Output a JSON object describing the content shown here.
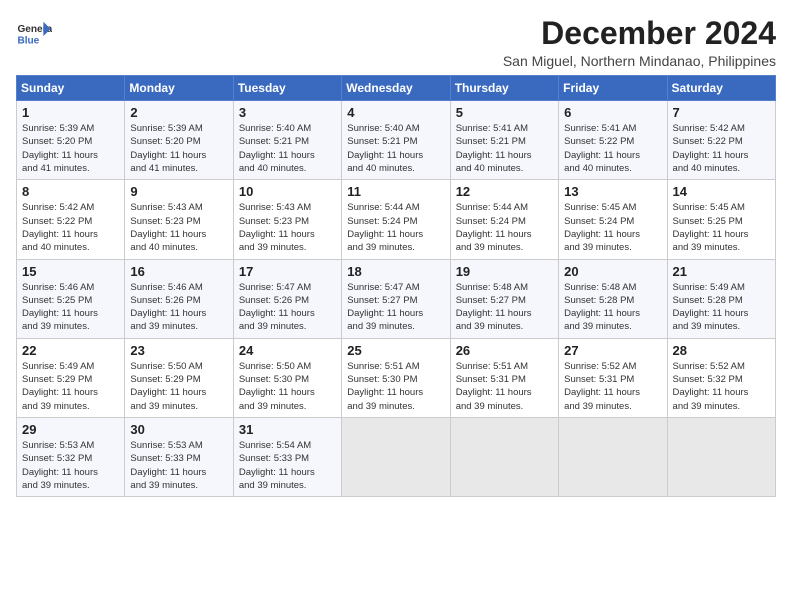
{
  "header": {
    "logo_line1": "General",
    "logo_line2": "Blue",
    "month": "December 2024",
    "location": "San Miguel, Northern Mindanao, Philippines"
  },
  "weekdays": [
    "Sunday",
    "Monday",
    "Tuesday",
    "Wednesday",
    "Thursday",
    "Friday",
    "Saturday"
  ],
  "weeks": [
    [
      {
        "day": 1,
        "sunrise": "5:39 AM",
        "sunset": "5:20 PM",
        "daylight": "11 hours and 41 minutes"
      },
      {
        "day": 2,
        "sunrise": "5:39 AM",
        "sunset": "5:20 PM",
        "daylight": "11 hours and 41 minutes"
      },
      {
        "day": 3,
        "sunrise": "5:40 AM",
        "sunset": "5:21 PM",
        "daylight": "11 hours and 40 minutes"
      },
      {
        "day": 4,
        "sunrise": "5:40 AM",
        "sunset": "5:21 PM",
        "daylight": "11 hours and 40 minutes"
      },
      {
        "day": 5,
        "sunrise": "5:41 AM",
        "sunset": "5:21 PM",
        "daylight": "11 hours and 40 minutes"
      },
      {
        "day": 6,
        "sunrise": "5:41 AM",
        "sunset": "5:22 PM",
        "daylight": "11 hours and 40 minutes"
      },
      {
        "day": 7,
        "sunrise": "5:42 AM",
        "sunset": "5:22 PM",
        "daylight": "11 hours and 40 minutes"
      }
    ],
    [
      {
        "day": 8,
        "sunrise": "5:42 AM",
        "sunset": "5:22 PM",
        "daylight": "11 hours and 40 minutes"
      },
      {
        "day": 9,
        "sunrise": "5:43 AM",
        "sunset": "5:23 PM",
        "daylight": "11 hours and 40 minutes"
      },
      {
        "day": 10,
        "sunrise": "5:43 AM",
        "sunset": "5:23 PM",
        "daylight": "11 hours and 39 minutes"
      },
      {
        "day": 11,
        "sunrise": "5:44 AM",
        "sunset": "5:24 PM",
        "daylight": "11 hours and 39 minutes"
      },
      {
        "day": 12,
        "sunrise": "5:44 AM",
        "sunset": "5:24 PM",
        "daylight": "11 hours and 39 minutes"
      },
      {
        "day": 13,
        "sunrise": "5:45 AM",
        "sunset": "5:24 PM",
        "daylight": "11 hours and 39 minutes"
      },
      {
        "day": 14,
        "sunrise": "5:45 AM",
        "sunset": "5:25 PM",
        "daylight": "11 hours and 39 minutes"
      }
    ],
    [
      {
        "day": 15,
        "sunrise": "5:46 AM",
        "sunset": "5:25 PM",
        "daylight": "11 hours and 39 minutes"
      },
      {
        "day": 16,
        "sunrise": "5:46 AM",
        "sunset": "5:26 PM",
        "daylight": "11 hours and 39 minutes"
      },
      {
        "day": 17,
        "sunrise": "5:47 AM",
        "sunset": "5:26 PM",
        "daylight": "11 hours and 39 minutes"
      },
      {
        "day": 18,
        "sunrise": "5:47 AM",
        "sunset": "5:27 PM",
        "daylight": "11 hours and 39 minutes"
      },
      {
        "day": 19,
        "sunrise": "5:48 AM",
        "sunset": "5:27 PM",
        "daylight": "11 hours and 39 minutes"
      },
      {
        "day": 20,
        "sunrise": "5:48 AM",
        "sunset": "5:28 PM",
        "daylight": "11 hours and 39 minutes"
      },
      {
        "day": 21,
        "sunrise": "5:49 AM",
        "sunset": "5:28 PM",
        "daylight": "11 hours and 39 minutes"
      }
    ],
    [
      {
        "day": 22,
        "sunrise": "5:49 AM",
        "sunset": "5:29 PM",
        "daylight": "11 hours and 39 minutes"
      },
      {
        "day": 23,
        "sunrise": "5:50 AM",
        "sunset": "5:29 PM",
        "daylight": "11 hours and 39 minutes"
      },
      {
        "day": 24,
        "sunrise": "5:50 AM",
        "sunset": "5:30 PM",
        "daylight": "11 hours and 39 minutes"
      },
      {
        "day": 25,
        "sunrise": "5:51 AM",
        "sunset": "5:30 PM",
        "daylight": "11 hours and 39 minutes"
      },
      {
        "day": 26,
        "sunrise": "5:51 AM",
        "sunset": "5:31 PM",
        "daylight": "11 hours and 39 minutes"
      },
      {
        "day": 27,
        "sunrise": "5:52 AM",
        "sunset": "5:31 PM",
        "daylight": "11 hours and 39 minutes"
      },
      {
        "day": 28,
        "sunrise": "5:52 AM",
        "sunset": "5:32 PM",
        "daylight": "11 hours and 39 minutes"
      }
    ],
    [
      {
        "day": 29,
        "sunrise": "5:53 AM",
        "sunset": "5:32 PM",
        "daylight": "11 hours and 39 minutes"
      },
      {
        "day": 30,
        "sunrise": "5:53 AM",
        "sunset": "5:33 PM",
        "daylight": "11 hours and 39 minutes"
      },
      {
        "day": 31,
        "sunrise": "5:54 AM",
        "sunset": "5:33 PM",
        "daylight": "11 hours and 39 minutes"
      },
      null,
      null,
      null,
      null
    ]
  ]
}
